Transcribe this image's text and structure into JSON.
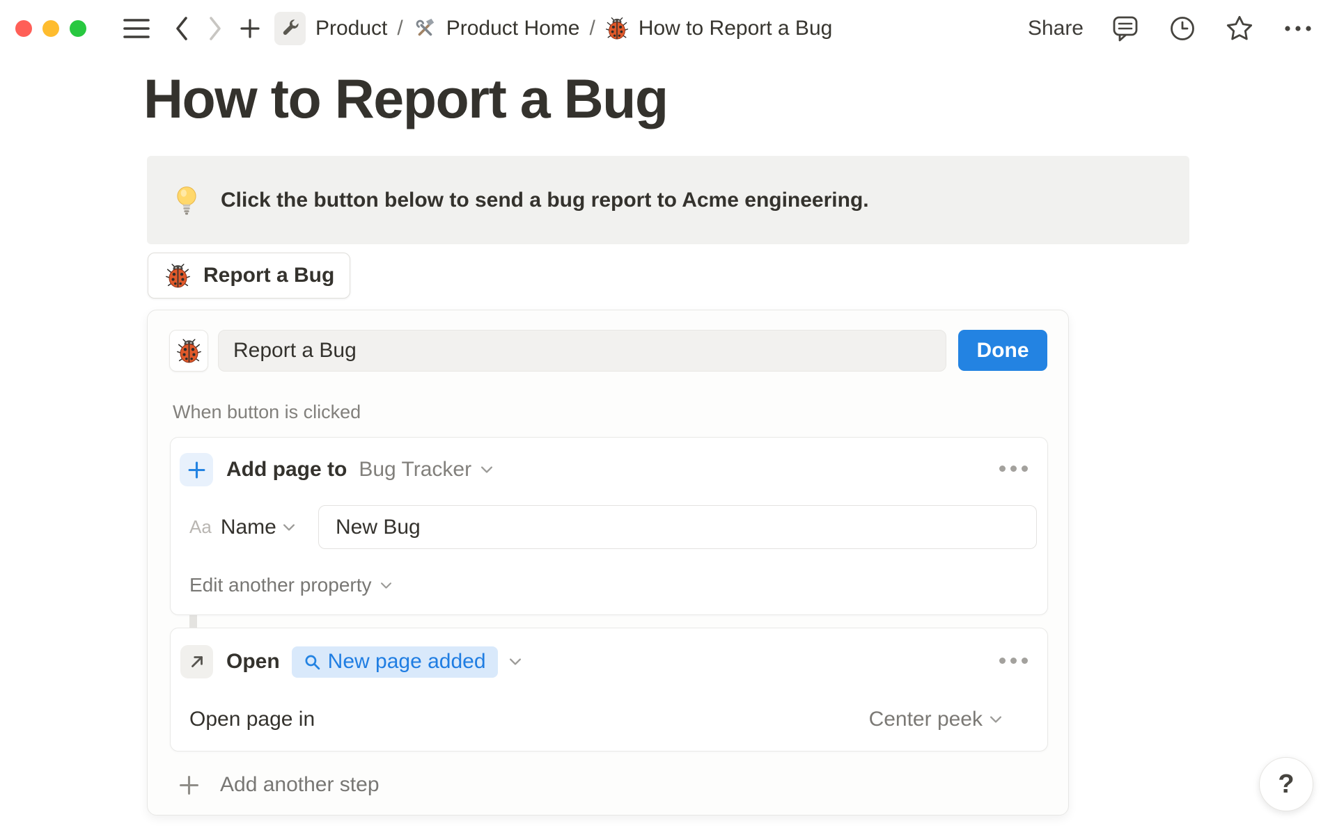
{
  "window": {
    "traffic_lights": [
      "#ff5f57",
      "#febc2e",
      "#28c840"
    ]
  },
  "topbar": {
    "separator": "/",
    "breadcrumb": [
      {
        "icon": "wrench",
        "label": "Product"
      },
      {
        "icon": "hammer-and-wrench",
        "label": "Product Home"
      },
      {
        "icon": "ladybug",
        "label": "How to Report a Bug"
      }
    ],
    "share_label": "Share",
    "icons": [
      "menu",
      "back",
      "forward",
      "new-tab",
      "comments",
      "updates-clock",
      "favorite-star",
      "more"
    ]
  },
  "page": {
    "title": "How to Report a Bug",
    "callout": {
      "icon": "lightbulb",
      "text": "Click the button below to send a bug report to Acme engineering."
    },
    "bug_button": {
      "icon": "ladybug",
      "label": "Report a Bug"
    }
  },
  "config_panel": {
    "button_icon": "ladybug",
    "button_name_value": "Report a Bug",
    "done_label": "Done",
    "trigger_label": "When button is clicked",
    "steps": [
      {
        "icon": "plus",
        "action": "Add page to",
        "target": "Bug Tracker",
        "property": {
          "type_abbrev": "Aa",
          "name": "Name",
          "value": "New Bug"
        },
        "edit_link": "Edit another property"
      },
      {
        "icon": "arrow-up-right",
        "action": "Open",
        "target_chip": "New page added",
        "open_in_label": "Open page in",
        "open_in_value": "Center peek"
      }
    ],
    "add_step_label": "Add another step"
  },
  "help": {
    "label": "?"
  },
  "colors": {
    "accent_blue": "#2383e2",
    "chip_bg": "#d9e9fb",
    "plus_box_bg": "#e8f1fc",
    "callout_bg": "#f1f1ef",
    "input_bg": "#f2f1ef",
    "text_dark": "#37352f",
    "text_gray": "#787774",
    "border": "#e9e9e7"
  }
}
